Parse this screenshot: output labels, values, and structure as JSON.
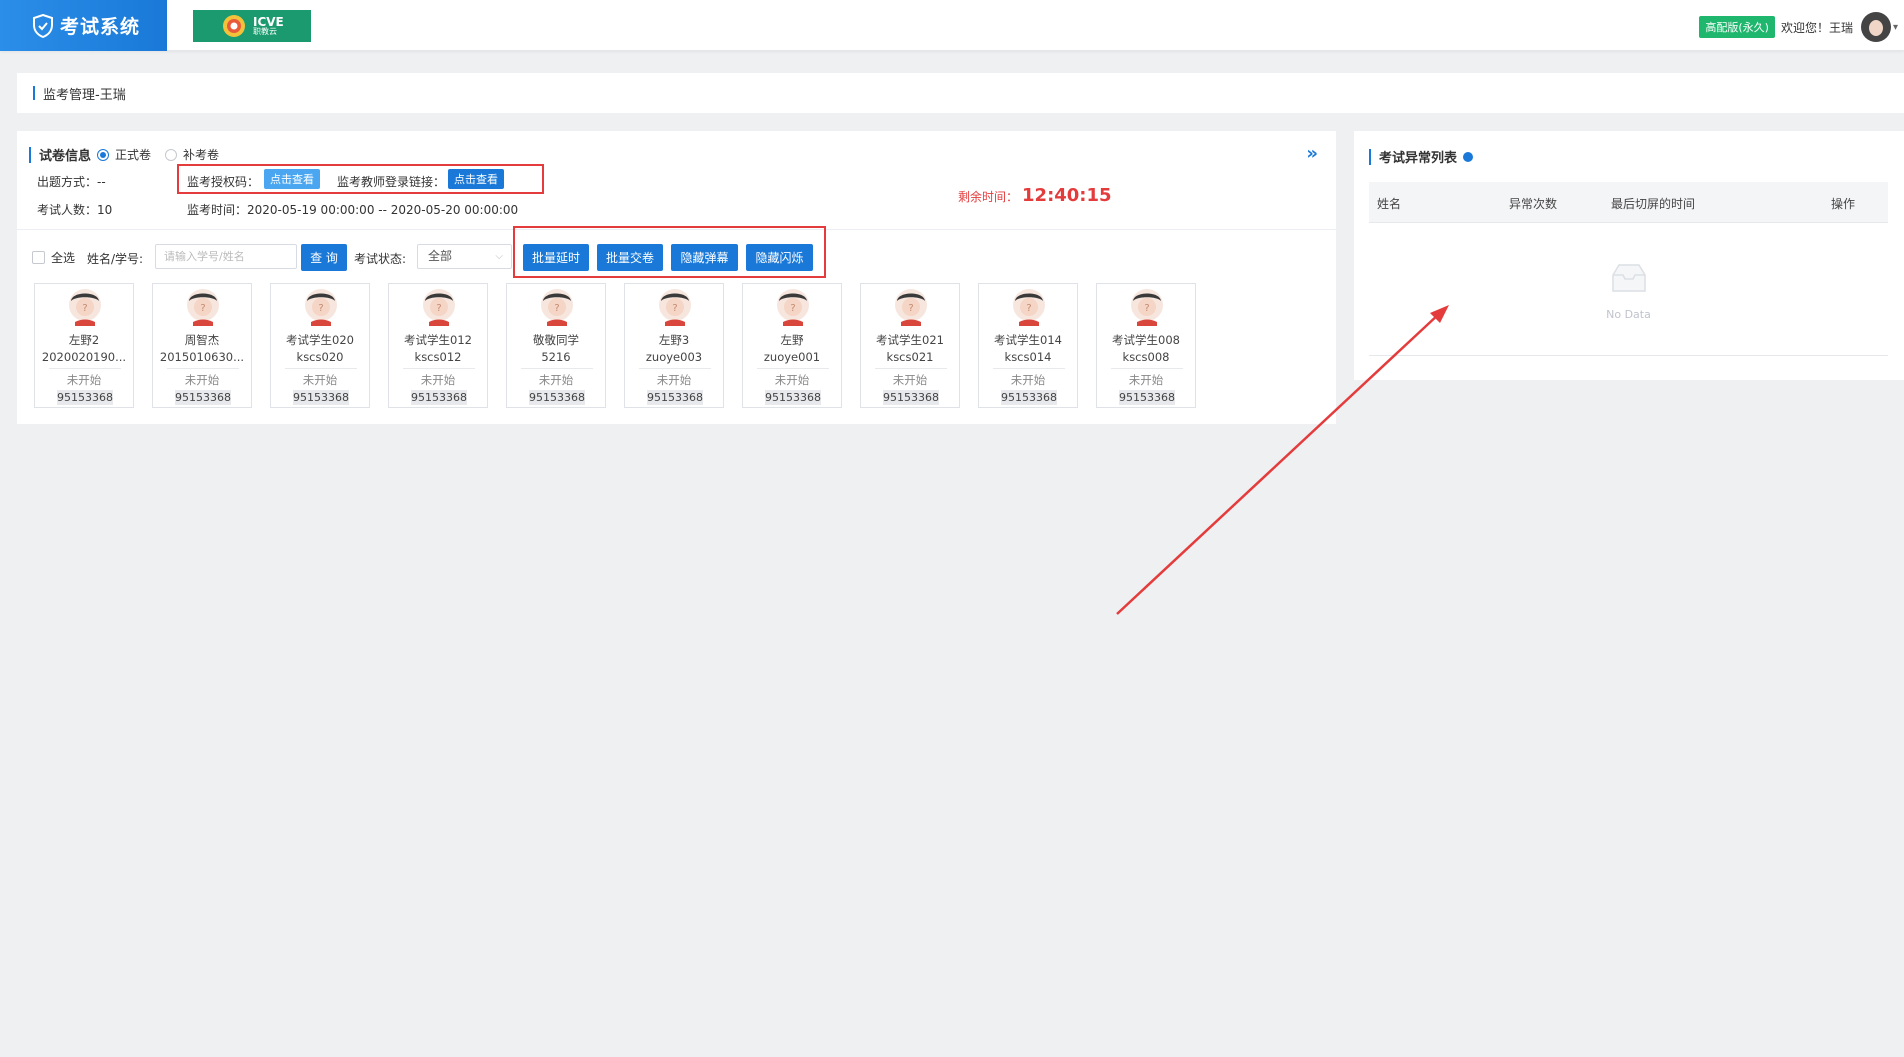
{
  "header": {
    "app_title": "考试系统",
    "logo2_line1": "ICVE",
    "logo2_line2": "职教云",
    "version_badge": "高配版(永久)",
    "welcome": "欢迎您！王瑞"
  },
  "breadcrumb": {
    "title": "监考管理-王瑞"
  },
  "paper": {
    "section_title": "试卷信息",
    "option_formal": "正式卷",
    "option_makeup": "补考卷",
    "mode_label": "出题方式：--",
    "auth_code_label": "监考授权码：",
    "auth_code_button": "点击查看",
    "login_link_label": "监考教师登录链接：",
    "login_link_button": "点击查看",
    "count_label": "考试人数：10",
    "time_label": "监考时间：2020-05-19 00:00:00 -- 2020-05-20 00:00:00",
    "remaining_label": "剩余时间：",
    "remaining_value": "12:40:15"
  },
  "filters": {
    "select_all": "全选",
    "name_label": "姓名/学号:",
    "search_placeholder": "请输入学号/姓名",
    "query_button": "查 询",
    "status_label": "考试状态:",
    "status_value": "全部",
    "batch_delay": "批量延时",
    "batch_submit": "批量交卷",
    "hide_barrage": "隐藏弹幕",
    "hide_flash": "隐藏闪烁"
  },
  "students": [
    {
      "name": "左野2",
      "id": "2020020190...",
      "status": "未开始",
      "code": "95153368"
    },
    {
      "name": "周智杰",
      "id": "2015010630...",
      "status": "未开始",
      "code": "95153368"
    },
    {
      "name": "考试学生020",
      "id": "kscs020",
      "status": "未开始",
      "code": "95153368"
    },
    {
      "name": "考试学生012",
      "id": "kscs012",
      "status": "未开始",
      "code": "95153368"
    },
    {
      "name": "敬敬同学",
      "id": "5216",
      "status": "未开始",
      "code": "95153368"
    },
    {
      "name": "左野3",
      "id": "zuoye003",
      "status": "未开始",
      "code": "95153368"
    },
    {
      "name": "左野",
      "id": "zuoye001",
      "status": "未开始",
      "code": "95153368"
    },
    {
      "name": "考试学生021",
      "id": "kscs021",
      "status": "未开始",
      "code": "95153368"
    },
    {
      "name": "考试学生014",
      "id": "kscs014",
      "status": "未开始",
      "code": "95153368"
    },
    {
      "name": "考试学生008",
      "id": "kscs008",
      "status": "未开始",
      "code": "95153368"
    }
  ],
  "abnormal": {
    "title": "考试异常列表",
    "columns": [
      "姓名",
      "异常次数",
      "最后切屏的时间",
      "操作"
    ],
    "empty_text": "No Data"
  },
  "colors": {
    "primary": "#1a79d8",
    "highlight": "#e43c3c",
    "badge": "#1fb66e"
  }
}
